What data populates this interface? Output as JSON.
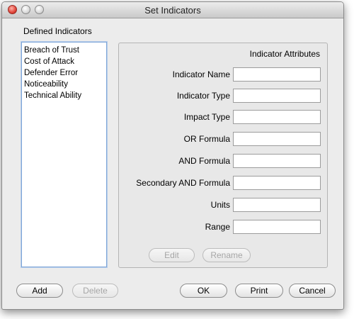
{
  "window": {
    "title": "Set Indicators"
  },
  "defined_indicators": {
    "label": "Defined Indicators",
    "items": [
      "Breach of Trust",
      "Cost of Attack",
      "Defender Error",
      "Noticeability",
      "Technical Ability"
    ]
  },
  "attributes": {
    "title": "Indicator Attributes",
    "fields": [
      {
        "label": "Indicator Name",
        "value": ""
      },
      {
        "label": "Indicator Type",
        "value": ""
      },
      {
        "label": "Impact Type",
        "value": ""
      },
      {
        "label": "OR Formula",
        "value": ""
      },
      {
        "label": "AND Formula",
        "value": ""
      },
      {
        "label": "Secondary AND Formula",
        "value": ""
      },
      {
        "label": "Units",
        "value": ""
      },
      {
        "label": "Range",
        "value": ""
      }
    ],
    "edit_label": "Edit",
    "rename_label": "Rename"
  },
  "footer": {
    "add_label": "Add",
    "delete_label": "Delete",
    "ok_label": "OK",
    "print_label": "Print",
    "cancel_label": "Cancel"
  },
  "colors": {
    "window_bg": "#ececec",
    "list_focus_border": "#7fa6d8",
    "close_light": "#e0443a"
  }
}
